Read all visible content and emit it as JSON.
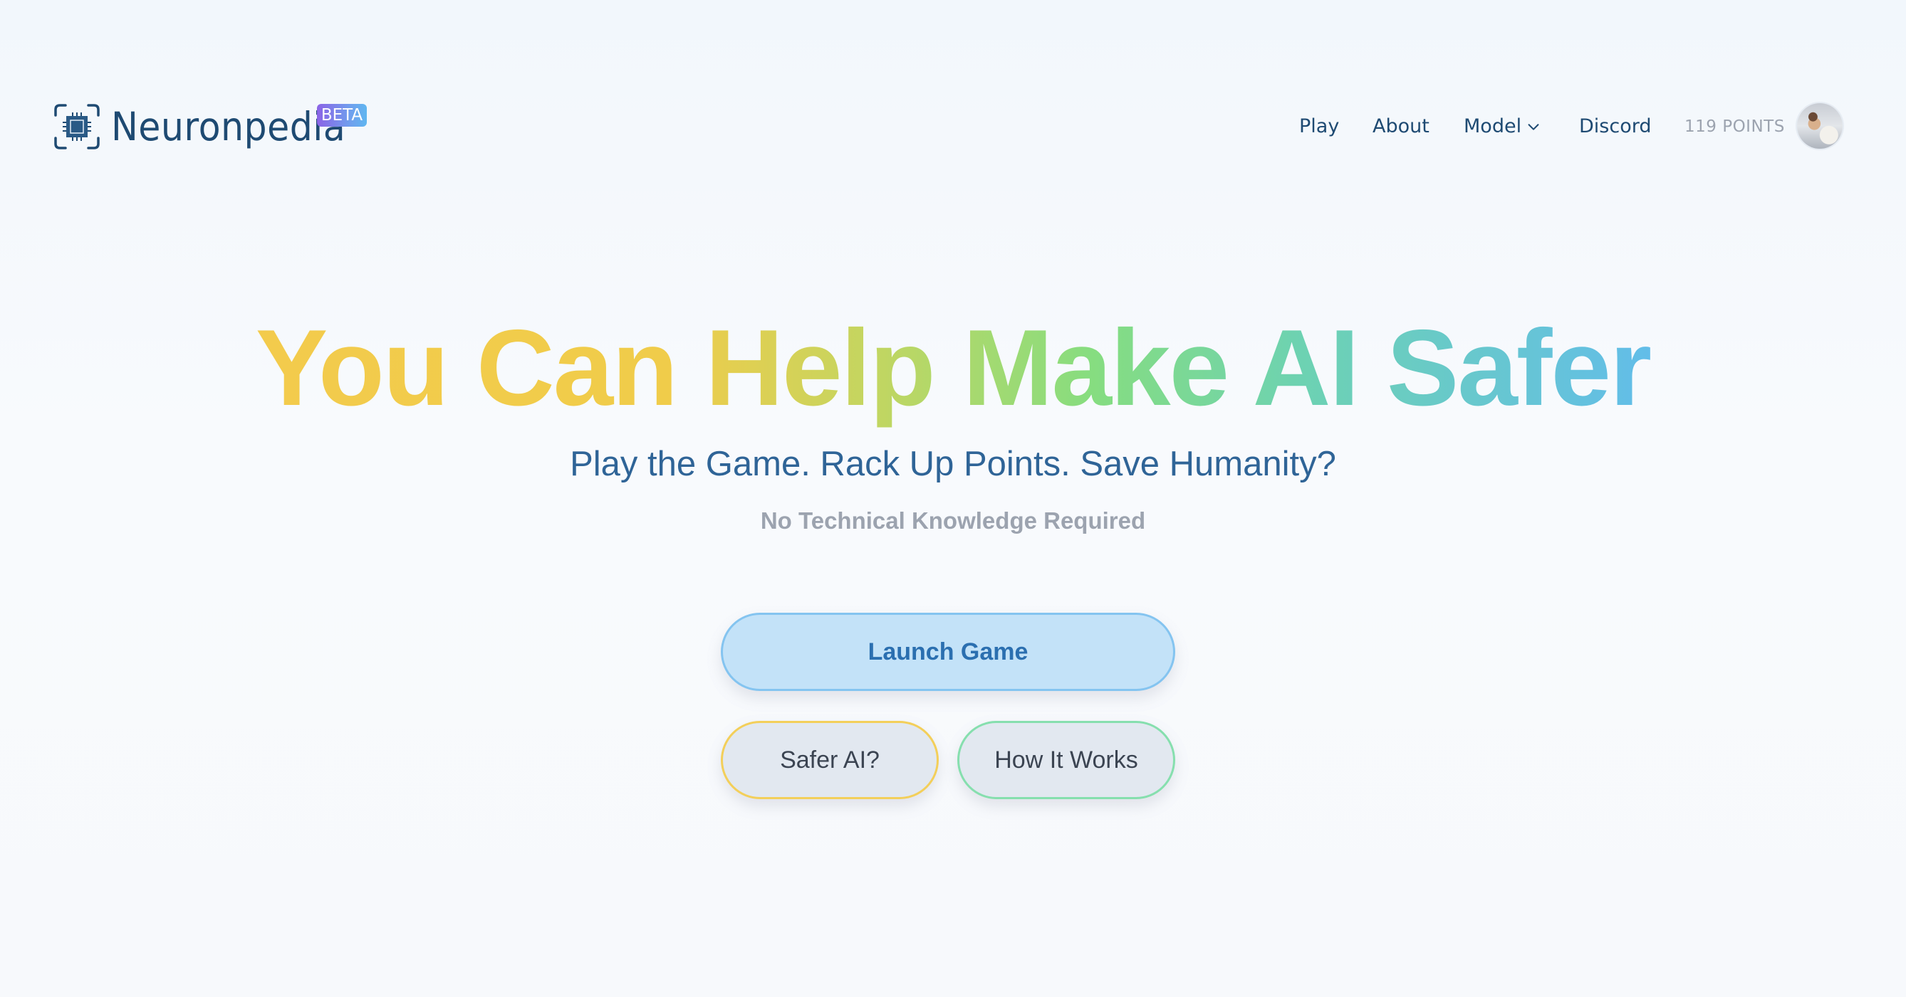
{
  "header": {
    "logo_text": "Neuronpedia",
    "logo_icon": "chip-icon",
    "badge": "BETA",
    "nav": [
      {
        "label": "Play"
      },
      {
        "label": "About"
      },
      {
        "label": "Model",
        "has_dropdown": true
      },
      {
        "label": "Discord"
      }
    ],
    "points": "119 POINTS",
    "avatar": "user-avatar"
  },
  "hero": {
    "headline": "You Can Help Make AI Safer",
    "subtitle": "Play the Game. Rack Up Points. Save Humanity?",
    "tagline": "No Technical Knowledge Required",
    "gradient_colors": [
      "#f3cb4c",
      "#c0d662",
      "#86dd80",
      "#6dd2b2",
      "#62bde9"
    ]
  },
  "buttons": {
    "launch": "Launch Game",
    "safer": "Safer AI?",
    "how": "How It Works"
  },
  "colors": {
    "brand": "#1e4a72",
    "launch_bg": "#c3e2f8",
    "launch_border": "#84c4f0",
    "safer_border": "#f3cf5a",
    "how_border": "#86dfae"
  }
}
